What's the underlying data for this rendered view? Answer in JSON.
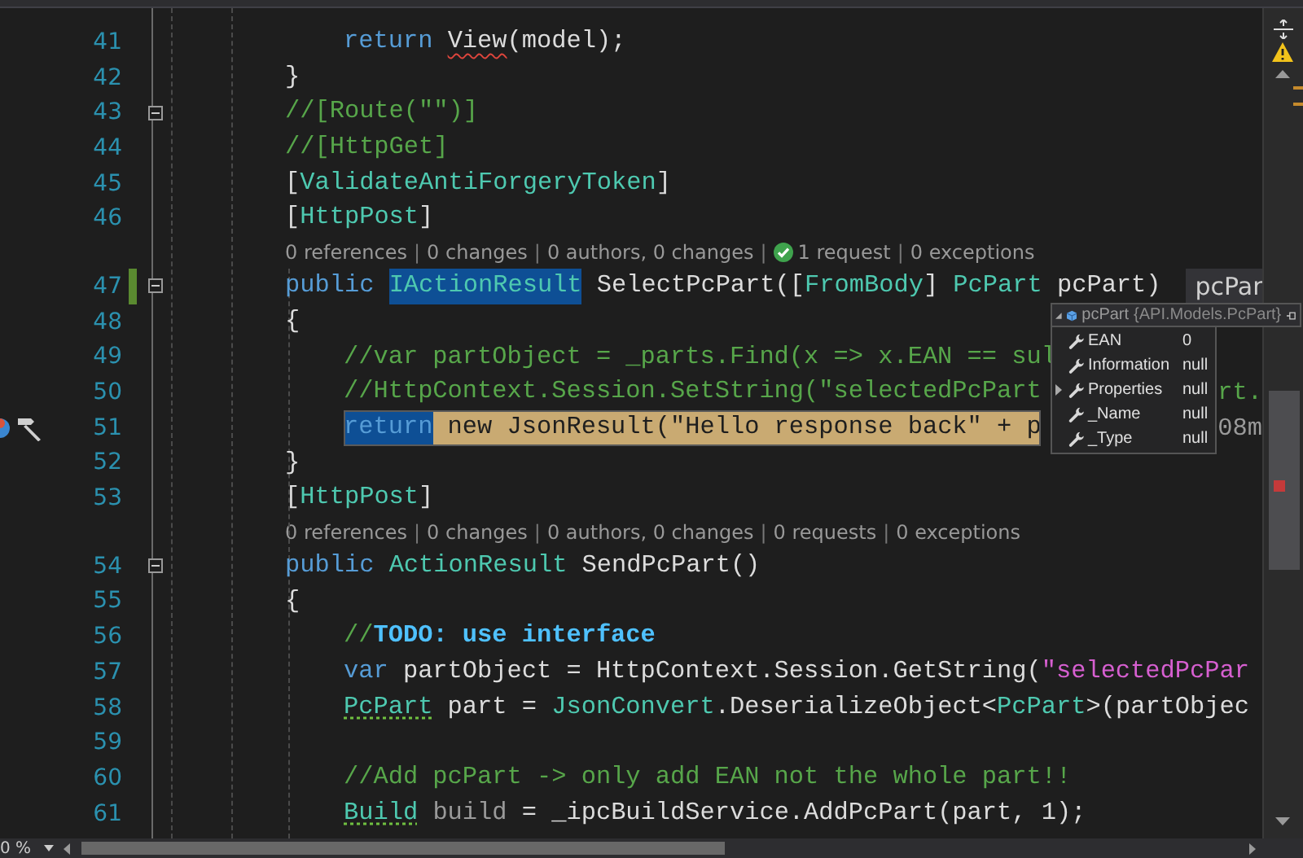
{
  "editor": {
    "lines": [
      {
        "kind": "body_code",
        "number": "41",
        "changed": false,
        "collapsible": false,
        "current": false,
        "actions": false,
        "tokens": [
          {
            "text": "return ",
            "kind": "keyword"
          },
          {
            "text": "View",
            "kind": "plain",
            "error": true
          },
          {
            "text": "(model);",
            "kind": "plain"
          }
        ]
      },
      {
        "kind": "member_code",
        "number": "42",
        "changed": false,
        "collapsible": false,
        "current": false,
        "actions": false,
        "tokens": [
          {
            "text": "}",
            "kind": "plain"
          }
        ]
      },
      {
        "kind": "member_code",
        "number": "43",
        "changed": false,
        "collapsible": true,
        "current": false,
        "actions": false,
        "tokens": [
          {
            "text": "//[Route(\"\")]",
            "kind": "comment"
          }
        ]
      },
      {
        "kind": "member_code",
        "number": "44",
        "changed": false,
        "collapsible": false,
        "current": false,
        "actions": false,
        "tokens": [
          {
            "text": "//[HttpGet]",
            "kind": "comment"
          }
        ]
      },
      {
        "kind": "member_code",
        "number": "45",
        "changed": false,
        "collapsible": false,
        "current": false,
        "actions": false,
        "tokens": [
          {
            "text": "[",
            "kind": "plain"
          },
          {
            "text": "ValidateAntiForgeryToken",
            "kind": "type"
          },
          {
            "text": "]",
            "kind": "plain"
          }
        ]
      },
      {
        "kind": "member_code",
        "number": "46",
        "changed": false,
        "collapsible": false,
        "current": false,
        "actions": false,
        "tokens": [
          {
            "text": "[",
            "kind": "plain"
          },
          {
            "text": "HttpPost",
            "kind": "type"
          },
          {
            "text": "]",
            "kind": "plain"
          }
        ]
      },
      {
        "kind": "lens",
        "items": [
          {
            "text": "0 references",
            "passed": false
          },
          {
            "separator": "|",
            "text": "0 changes",
            "passed": false
          },
          {
            "separator": "|",
            "text": "0 authors, 0 changes",
            "passed": false
          },
          {
            "separator": "|",
            "text": "1 request",
            "passed": true
          },
          {
            "separator": "|",
            "text": "0 exceptions",
            "passed": false
          }
        ]
      },
      {
        "kind": "member_code",
        "number": "47",
        "changed": true,
        "collapsible": true,
        "current": false,
        "actions": false,
        "tokens": [
          {
            "text": "public ",
            "kind": "keyword"
          },
          {
            "text": "IActionResult",
            "kind": "type",
            "selected": true
          },
          {
            "text": " SelectPcPart([",
            "kind": "plain"
          },
          {
            "text": "FromBody",
            "kind": "type"
          },
          {
            "text": "] ",
            "kind": "plain"
          },
          {
            "text": "PcPart",
            "kind": "type"
          },
          {
            "text": " pcPart)",
            "kind": "plain"
          }
        ],
        "datatip": "pcPar"
      },
      {
        "kind": "member_code",
        "number": "48",
        "changed": false,
        "collapsible": false,
        "current": false,
        "actions": false,
        "tokens": [
          {
            "text": "{",
            "kind": "plain"
          }
        ]
      },
      {
        "kind": "body_code",
        "number": "49",
        "changed": false,
        "collapsible": false,
        "current": false,
        "actions": false,
        "tokens": [
          {
            "text": "//var partObject = _parts.Find(x => x.EAN == sul",
            "kind": "comment"
          }
        ]
      },
      {
        "kind": "body_code",
        "number": "50",
        "changed": false,
        "collapsible": false,
        "current": false,
        "actions": false,
        "tokens": [
          {
            "text": "//HttpContext.Session.SetString(\"selectedPcPart",
            "kind": "comment"
          }
        ],
        "tail": {
          "text": "rt.",
          "kind": "comment"
        }
      },
      {
        "kind": "body_code",
        "number": "51",
        "changed": false,
        "collapsible": false,
        "current": true,
        "actions": true,
        "tokens": [
          {
            "text": "return",
            "kind": "keyword",
            "selected": true
          },
          {
            "text": " new JsonResult(\"Hello response back\" + p",
            "kind": "statement"
          }
        ],
        "tail": {
          "text": "08m",
          "kind": "faded"
        }
      },
      {
        "kind": "member_code",
        "number": "52",
        "changed": false,
        "collapsible": false,
        "current": false,
        "actions": false,
        "tokens": [
          {
            "text": "}",
            "kind": "plain"
          }
        ]
      },
      {
        "kind": "member_code",
        "number": "53",
        "changed": false,
        "collapsible": false,
        "current": false,
        "actions": false,
        "tokens": [
          {
            "text": "[",
            "kind": "plain"
          },
          {
            "text": "HttpPost",
            "kind": "type"
          },
          {
            "text": "]",
            "kind": "plain"
          }
        ]
      },
      {
        "kind": "lens",
        "items": [
          {
            "text": "0 references",
            "passed": false
          },
          {
            "separator": "|",
            "text": "0 changes",
            "passed": false
          },
          {
            "separator": "|",
            "text": "0 authors, 0 changes",
            "passed": false
          },
          {
            "separator": "|",
            "text": "0 requests",
            "passed": false
          },
          {
            "separator": "|",
            "text": "0 exceptions",
            "passed": false
          }
        ]
      },
      {
        "kind": "member_code",
        "number": "54",
        "changed": false,
        "collapsible": true,
        "current": false,
        "actions": false,
        "tokens": [
          {
            "text": "public ",
            "kind": "keyword"
          },
          {
            "text": "ActionResult",
            "kind": "type"
          },
          {
            "text": " SendPcPart()",
            "kind": "plain"
          }
        ]
      },
      {
        "kind": "member_code",
        "number": "55",
        "changed": false,
        "collapsible": false,
        "current": false,
        "actions": false,
        "tokens": [
          {
            "text": "{",
            "kind": "plain"
          }
        ]
      },
      {
        "kind": "body_code",
        "number": "56",
        "changed": false,
        "collapsible": false,
        "current": false,
        "actions": false,
        "tokens": [
          {
            "text": "//",
            "kind": "comment"
          },
          {
            "text": "TODO: use interface",
            "kind": "todo"
          }
        ]
      },
      {
        "kind": "body_code",
        "number": "57",
        "changed": false,
        "collapsible": false,
        "current": false,
        "actions": false,
        "tokens": [
          {
            "text": "var",
            "kind": "keyword"
          },
          {
            "text": " partObject = HttpContext.Session.GetString(",
            "kind": "plain"
          },
          {
            "text": "\"selectedPcPar",
            "kind": "string"
          }
        ]
      },
      {
        "kind": "body_code",
        "number": "58",
        "changed": false,
        "collapsible": false,
        "current": false,
        "actions": false,
        "tokens": [
          {
            "text": "PcPart",
            "kind": "type",
            "suggestion": true
          },
          {
            "text": " part = ",
            "kind": "plain"
          },
          {
            "text": "JsonConvert",
            "kind": "type"
          },
          {
            "text": ".DeserializeObject<",
            "kind": "plain"
          },
          {
            "text": "PcPart",
            "kind": "type"
          },
          {
            "text": ">(partObjec",
            "kind": "plain"
          }
        ]
      },
      {
        "kind": "body_code",
        "number": "59",
        "changed": false,
        "collapsible": false,
        "current": false,
        "actions": false
      },
      {
        "kind": "body_code",
        "number": "60",
        "changed": false,
        "collapsible": false,
        "current": false,
        "actions": false,
        "tokens": [
          {
            "text": "//Add pcPart -> only add EAN not the whole part!!",
            "kind": "comment"
          }
        ]
      },
      {
        "kind": "body_code",
        "number": "61",
        "changed": false,
        "collapsible": false,
        "current": false,
        "actions": false,
        "tokens": [
          {
            "text": "Build",
            "kind": "type",
            "suggestion": true
          },
          {
            "text": " build",
            "kind": "faded"
          },
          {
            "text": " = _ipcBuildService.AddPcPart(part, 1);",
            "kind": "plain"
          }
        ]
      }
    ]
  },
  "datatip": {
    "expanded": true,
    "name": "pcPart",
    "type": "{API.Models.PcPart}",
    "members": [
      {
        "name": "EAN",
        "value": "0",
        "expandable": false
      },
      {
        "name": "Information",
        "value": "null",
        "expandable": false
      },
      {
        "name": "Properties",
        "value": "null",
        "expandable": true
      },
      {
        "name": "_Name",
        "value": "null",
        "expandable": false
      },
      {
        "name": "_Type",
        "value": "null",
        "expandable": false
      }
    ]
  },
  "status_bar": {
    "zoom": "0 %"
  }
}
